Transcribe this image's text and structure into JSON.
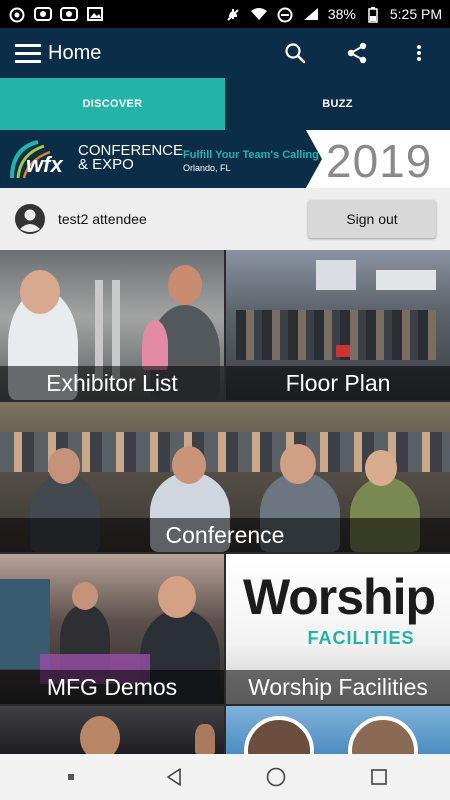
{
  "status_bar": {
    "battery": "38%",
    "time": "5:25 PM",
    "icons": [
      "whatsapp-icon",
      "camera-icon",
      "camera-icon",
      "image-icon",
      "mute-icon",
      "wifi-icon",
      "do-not-disturb-icon",
      "signal-icon",
      "battery-icon"
    ]
  },
  "app_bar": {
    "title": "Home",
    "icons": [
      "menu-icon",
      "search-icon",
      "share-icon",
      "more-vert-icon"
    ]
  },
  "tabs": [
    {
      "label": "DISCOVER",
      "active": true
    },
    {
      "label": "BUZZ",
      "active": false
    }
  ],
  "banner": {
    "logo": "wfx",
    "conference_line1": "CONFERENCE",
    "conference_line2": "& EXPO",
    "tagline": "Fulfill Your Team's Calling",
    "location": "Orlando, FL",
    "year": "2019"
  },
  "user": {
    "name": "test2 attendee",
    "sign_out_label": "Sign out"
  },
  "tiles": [
    {
      "label": "Exhibitor List"
    },
    {
      "label": "Floor Plan"
    },
    {
      "label": "Conference"
    },
    {
      "label": "MFG Demos"
    },
    {
      "label": "Worship Facilities",
      "image_word1": "Worship",
      "image_word2": "FACILITIES"
    },
    {
      "label": ""
    },
    {
      "label": ""
    }
  ],
  "colors": {
    "primary": "#0c2d48",
    "accent": "#24b3a7"
  },
  "nav_bar": {
    "icons": [
      "dot-icon",
      "back-icon",
      "home-icon",
      "recents-icon"
    ]
  }
}
